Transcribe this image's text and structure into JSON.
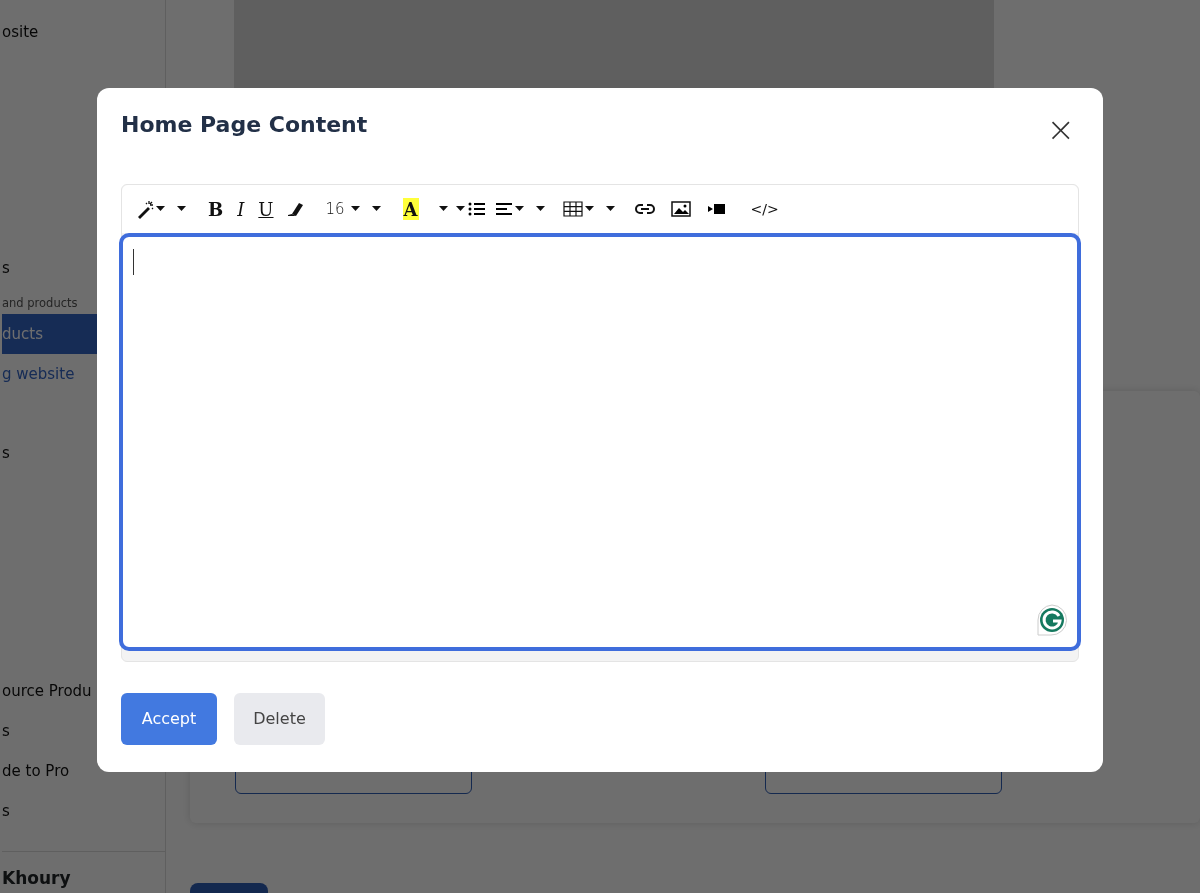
{
  "sidebar": {
    "items": [
      {
        "kind": "item",
        "label": "osite",
        "selected": false
      },
      {
        "kind": "item",
        "label": "s",
        "selected": false
      },
      {
        "kind": "heading",
        "label": "and products"
      },
      {
        "kind": "item",
        "label": "ducts",
        "selected": true
      },
      {
        "kind": "link",
        "label": "g website",
        "selected": false
      },
      {
        "kind": "item",
        "label": "s",
        "selected": false
      },
      {
        "kind": "item",
        "label": "ource Produ",
        "selected": false
      },
      {
        "kind": "item",
        "label": "s",
        "selected": false
      },
      {
        "kind": "item",
        "label": "de to Pro",
        "selected": false
      },
      {
        "kind": "item",
        "label": "s",
        "selected": false
      }
    ],
    "user": "Khoury"
  },
  "modal": {
    "title": "Home Page Content",
    "close": "×",
    "toolbar": {
      "bold": "B",
      "italic": "I",
      "underline": "U",
      "font_size": "16",
      "highlight": "A",
      "code": "</>"
    },
    "editor": {
      "focused": true
    },
    "buttons": [
      {
        "label": "Accept",
        "kind": "primary"
      },
      {
        "label": "Delete",
        "kind": "secondary"
      }
    ]
  }
}
